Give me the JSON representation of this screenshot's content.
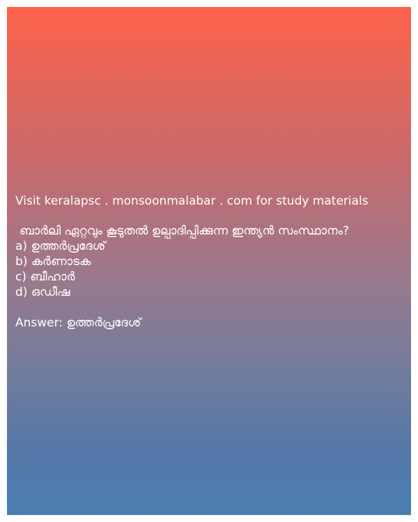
{
  "visit_text": "Visit keralapsc . monsoonmalabar . com for study materials",
  "question": "ബാർലി ഏറ്റവും കൂടുതൽ ഉല്പാദിപ്പിക്കുന്ന ഇന്ത്യൻ സംസ്ഥാനം?",
  "options": [
    "a) ഉത്തർപ്രദേശ്",
    "b) കർണാടക",
    "c) ബീഹാർ",
    "d) ഒഡീഷ"
  ],
  "answer": "Answer: ഉത്തർപ്രദേശ്",
  "colors": {
    "gradient_top": "#fe624a",
    "gradient_bottom": "#4a7fb3",
    "text": "#ffffff"
  }
}
